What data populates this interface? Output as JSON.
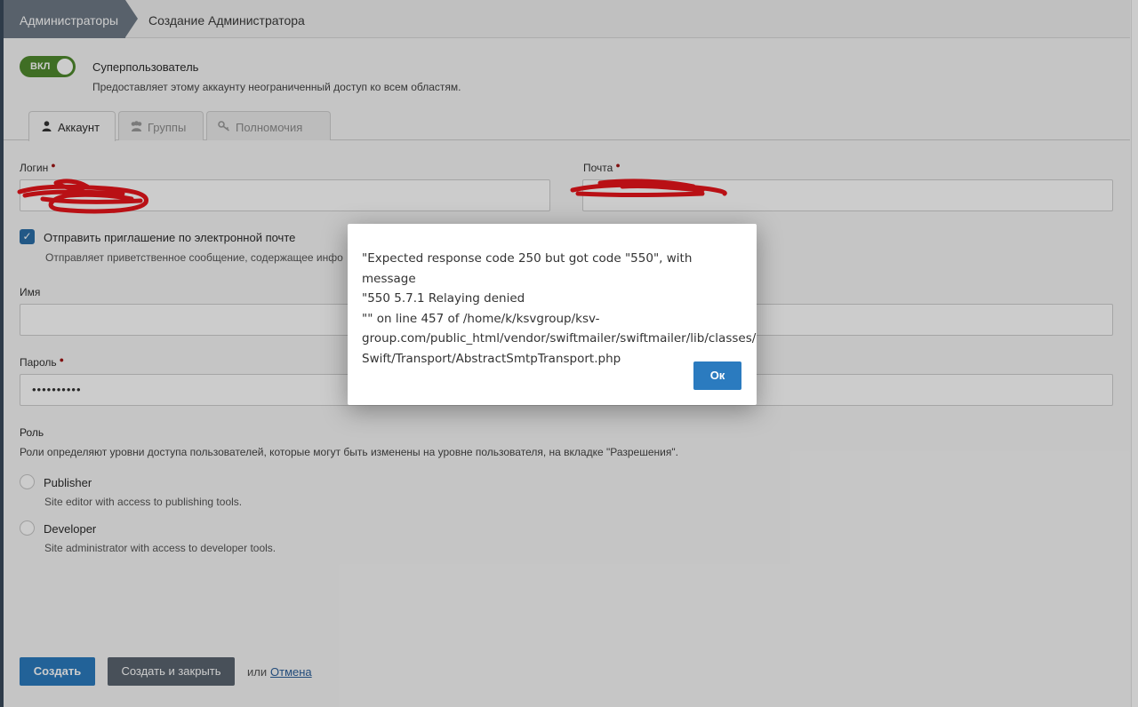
{
  "breadcrumb": {
    "items": [
      "Администраторы",
      "Создание Администратора"
    ]
  },
  "superuser": {
    "toggle_label": "ВКЛ",
    "title": "Суперпользователь",
    "description": "Предоставляет этому аккаунту неограниченный доступ ко всем областям."
  },
  "tabs": [
    {
      "label": "Аккаунт",
      "icon": "user-icon",
      "active": true
    },
    {
      "label": "Группы",
      "icon": "users-icon",
      "active": false
    },
    {
      "label": "Полномочия",
      "icon": "key-icon",
      "active": false
    }
  ],
  "form": {
    "login_label": "Логин",
    "email_label": "Почта",
    "send_invite_label": "Отправить приглашение по электронной почте",
    "send_invite_desc": "Отправляет приветственное сообщение, содержащее инфо",
    "name_label": "Имя",
    "password_label": "Пароль",
    "password_value": "••••••••••",
    "role_title": "Роль",
    "role_desc": "Роли определяют уровни доступа пользователей, которые могут быть изменены на уровне пользователя, на вкладке \"Разрешения\".",
    "roles": [
      {
        "label": "Publisher",
        "desc": "Site editor with access to publishing tools."
      },
      {
        "label": "Developer",
        "desc": "Site administrator with access to developer tools."
      }
    ]
  },
  "footer": {
    "create_label": "Создать",
    "create_close_label": "Создать и закрыть",
    "or_text": "или",
    "cancel_label": "Отмена"
  },
  "modal": {
    "message": "\"Expected response code 250 but got code \"550\", with message\n\"550 5.7.1 Relaying denied\n\"\" on line 457 of /home/k/ksvgroup/ksv-\ngroup.com/public_html/vendor/swiftmailer/swiftmailer/lib/classes/\nSwift/Transport/AbstractSmtpTransport.php",
    "ok_label": "Ок"
  },
  "colors": {
    "accent": "#2b7bbf",
    "toggle_on": "#4f8a2e",
    "required": "#a01414",
    "redaction": "#e8151b"
  }
}
